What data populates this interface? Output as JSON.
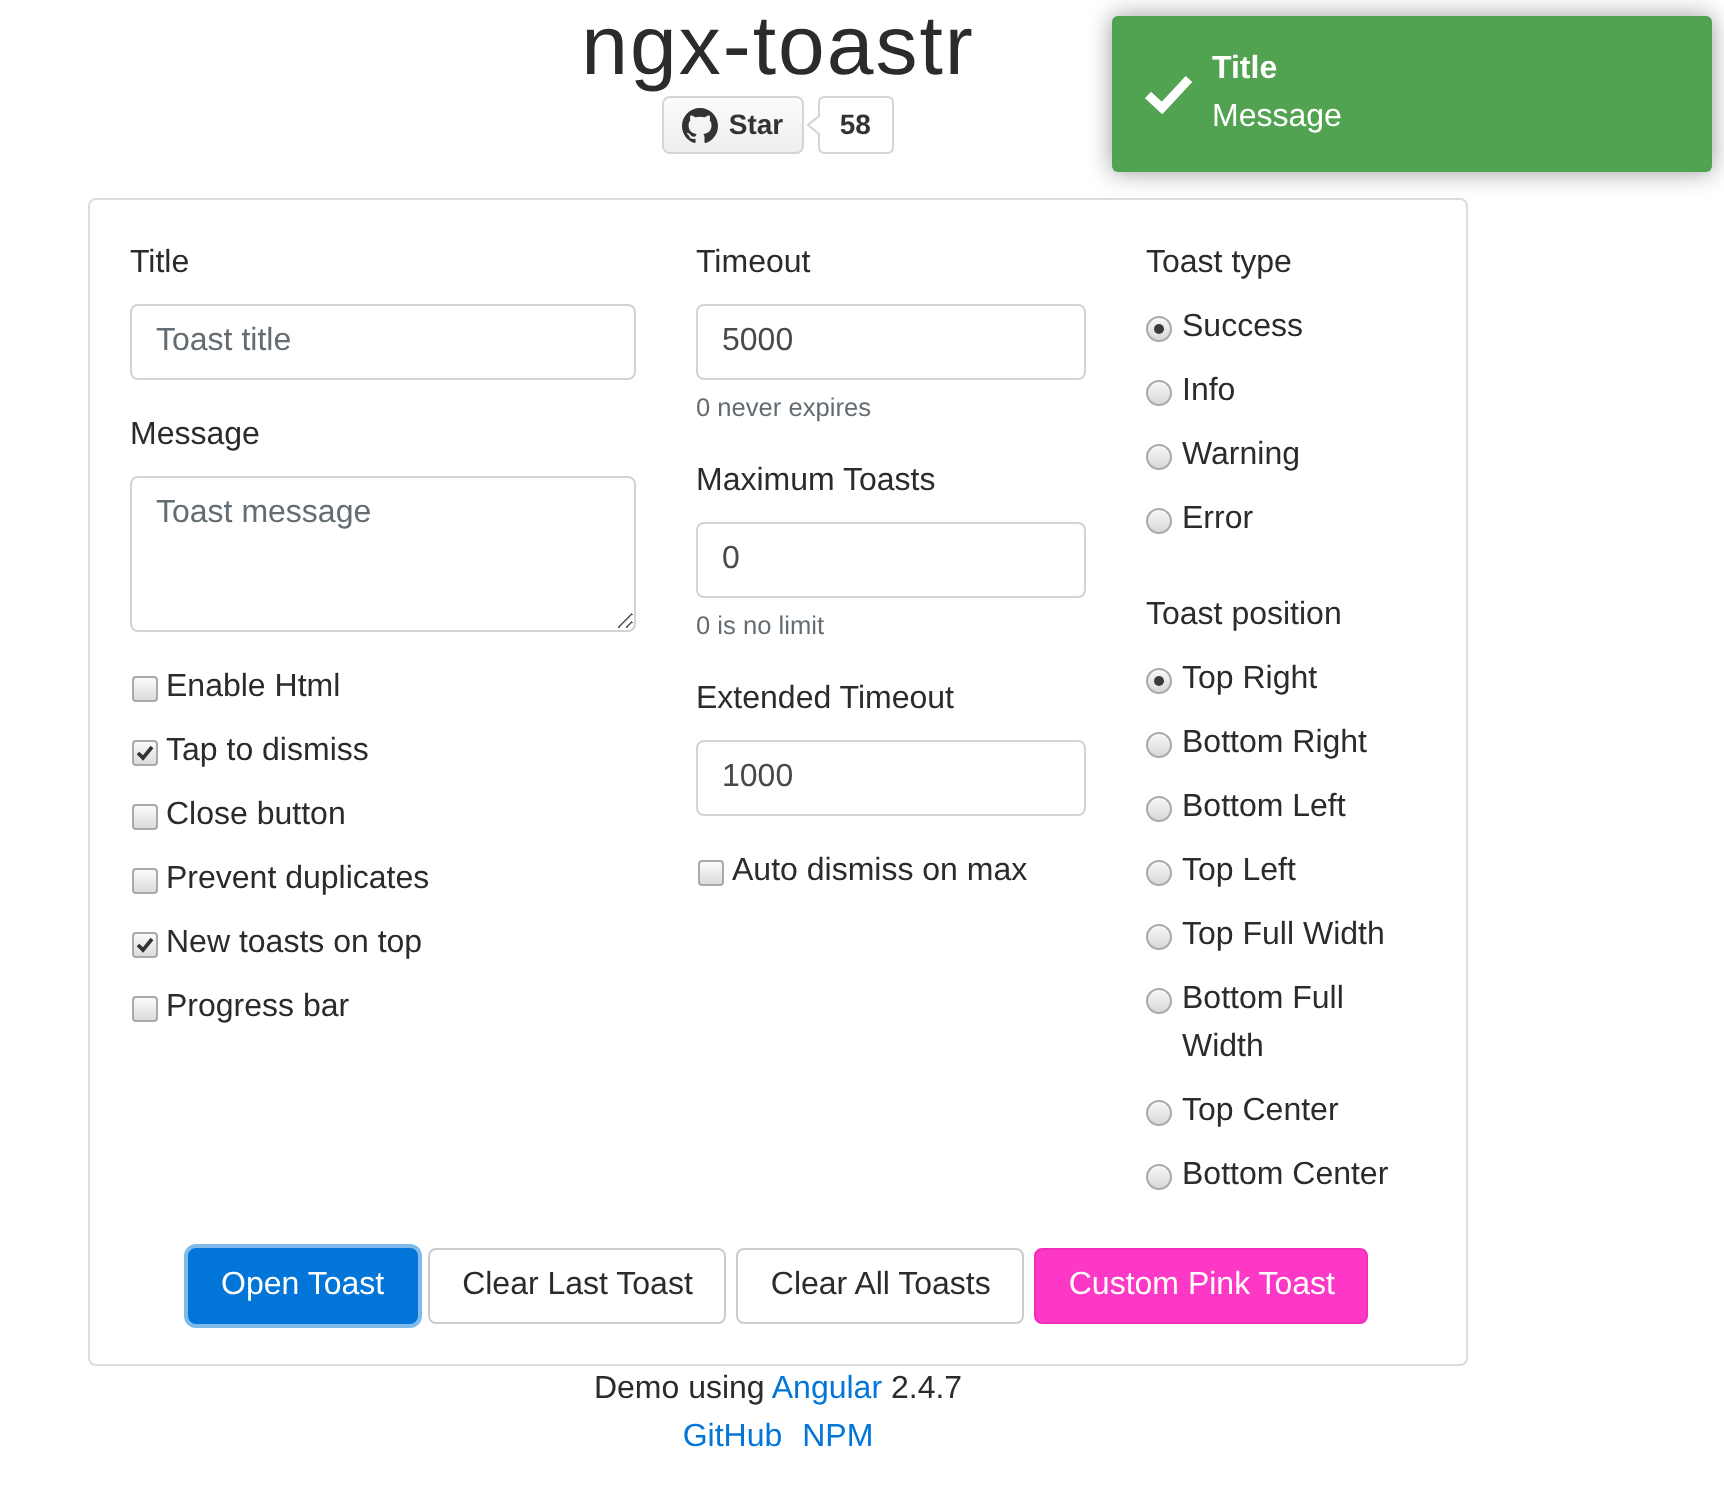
{
  "header": {
    "title": "ngx-toastr",
    "star_button": {
      "label": "Star"
    },
    "star_count": "58"
  },
  "toast": {
    "kind": "success",
    "title": "Title",
    "message": "Message"
  },
  "form": {
    "title_field": {
      "label": "Title",
      "placeholder": "Toast title"
    },
    "message_field": {
      "label": "Message",
      "placeholder": "Toast message"
    },
    "options": [
      {
        "label": "Enable Html",
        "checked": false
      },
      {
        "label": "Tap to dismiss",
        "checked": true
      },
      {
        "label": "Close button",
        "checked": false
      },
      {
        "label": "Prevent duplicates",
        "checked": false
      },
      {
        "label": "New toasts on top",
        "checked": true
      },
      {
        "label": "Progress bar",
        "checked": false
      }
    ],
    "number_fields": [
      {
        "label": "Timeout",
        "value": "5000",
        "help": "0 never expires"
      },
      {
        "label": "Maximum Toasts",
        "value": "0",
        "help": "0 is no limit"
      },
      {
        "label": "Extended Timeout",
        "value": "1000"
      }
    ],
    "max_options": [
      {
        "label": "Auto dismiss on max",
        "checked": false
      }
    ],
    "radio_groups": [
      {
        "label": "Toast type",
        "options": [
          {
            "label": "Success",
            "selected": true
          },
          {
            "label": "Info",
            "selected": false
          },
          {
            "label": "Warning",
            "selected": false
          },
          {
            "label": "Error",
            "selected": false
          }
        ]
      },
      {
        "label": "Toast position",
        "options": [
          {
            "label": "Top Right",
            "selected": true
          },
          {
            "label": "Bottom Right",
            "selected": false
          },
          {
            "label": "Bottom Left",
            "selected": false
          },
          {
            "label": "Top Left",
            "selected": false
          },
          {
            "label": "Top Full Width",
            "selected": false
          },
          {
            "label": "Bottom Full Width",
            "selected": false
          },
          {
            "label": "Top Center",
            "selected": false
          },
          {
            "label": "Bottom Center",
            "selected": false
          }
        ]
      }
    ],
    "buttons": [
      {
        "label": "Open Toast",
        "kind": "primary",
        "focused": true
      },
      {
        "label": "Clear Last Toast",
        "kind": "default",
        "focused": false
      },
      {
        "label": "Clear All Toasts",
        "kind": "default",
        "focused": false
      },
      {
        "label": "Custom Pink Toast",
        "kind": "pink",
        "focused": false
      }
    ]
  },
  "footer": {
    "credit": {
      "text": "Demo using",
      "link": "Angular",
      "version": "2.4.7"
    },
    "links": [
      {
        "label": "GitHub"
      },
      {
        "label": "NPM"
      }
    ]
  }
}
